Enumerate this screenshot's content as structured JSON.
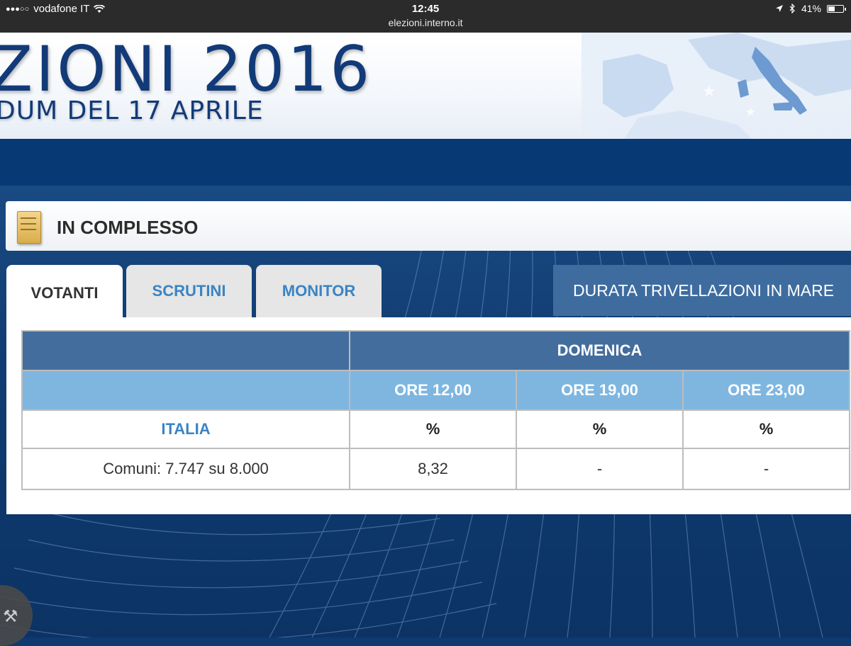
{
  "status_bar": {
    "signal_dots": "●●●○○",
    "carrier": "vodafone IT",
    "time": "12:45",
    "url": "elezioni.interno.it",
    "battery": "41%"
  },
  "banner": {
    "title": "ZIONI 2016",
    "subtitle": "DUM DEL 17 APRILE"
  },
  "section": {
    "title": "IN COMPLESSO"
  },
  "tabs": [
    {
      "label": "VOTANTI",
      "active": true
    },
    {
      "label": "SCRUTINI",
      "active": false
    },
    {
      "label": "MONITOR",
      "active": false
    }
  ],
  "side_tab": {
    "label": "DURATA TRIVELLAZIONI IN MARE"
  },
  "table": {
    "day_header": "DOMENICA",
    "time_headers": [
      "ORE 12,00",
      "ORE 19,00",
      "ORE 23,00"
    ],
    "area_label": "ITALIA",
    "unit_headers": [
      "%",
      "%",
      "%"
    ],
    "comuni_label": "Comuni: 7.747 su 8.000",
    "values": [
      "8,32",
      "-",
      "-"
    ]
  },
  "colors": {
    "navy": "#073a75",
    "header_blue": "#436d9d",
    "light_blue": "#7fb6e0",
    "link_blue": "#3a84c4"
  }
}
